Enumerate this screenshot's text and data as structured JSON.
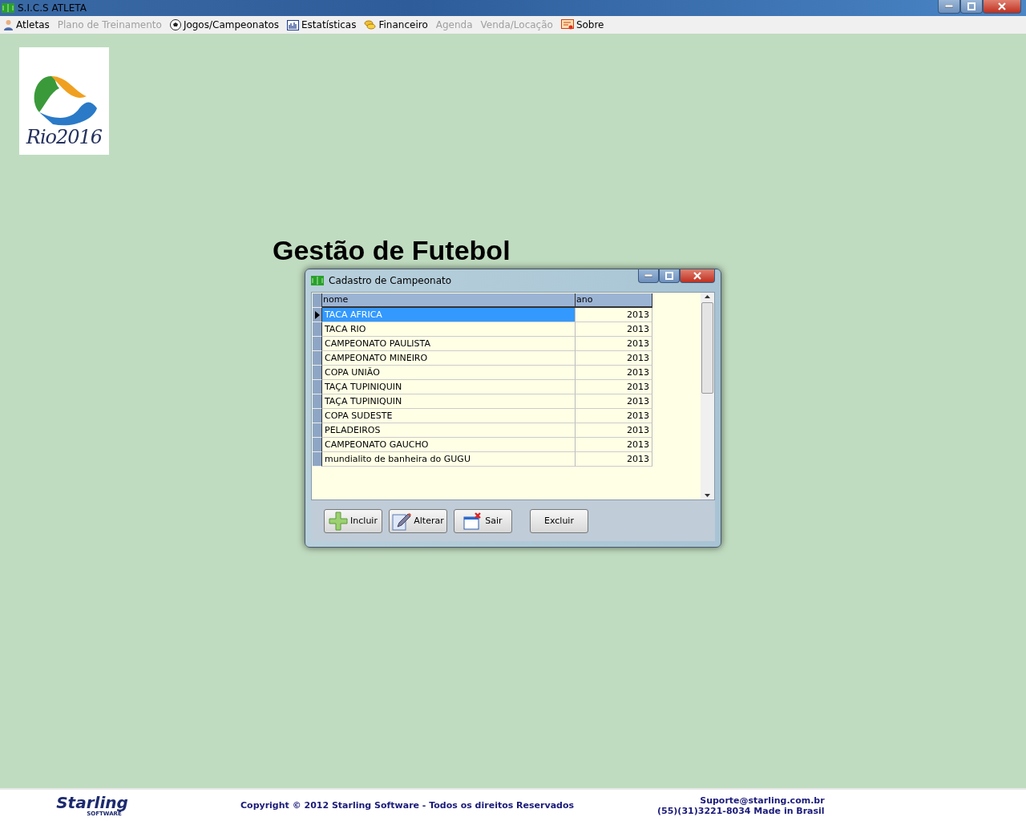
{
  "window": {
    "title": "S.I.C.S ATLETA"
  },
  "menu": [
    {
      "label": "Atletas",
      "disabled": false
    },
    {
      "label": "Plano de Treinamento",
      "disabled": true
    },
    {
      "label": "Jogos/Campeonatos",
      "disabled": false
    },
    {
      "label": "Estatísticas",
      "disabled": false
    },
    {
      "label": "Financeiro",
      "disabled": false
    },
    {
      "label": "Agenda",
      "disabled": true
    },
    {
      "label": "Venda/Locação",
      "disabled": true
    },
    {
      "label": "Sobre",
      "disabled": false
    }
  ],
  "logo": {
    "text": "Rio2016"
  },
  "heading": "Gestão de Futebol",
  "dialog": {
    "title": "Cadastro de Campeonato",
    "table": {
      "columns": [
        "nome",
        "ano"
      ],
      "rows": [
        {
          "nome": "TACA AFRICA",
          "ano": "2013",
          "selected": true
        },
        {
          "nome": "TACA RIO",
          "ano": "2013",
          "selected": false
        },
        {
          "nome": "CAMPEONATO PAULISTA",
          "ano": "2013",
          "selected": false
        },
        {
          "nome": "CAMPEONATO MINEIRO",
          "ano": "2013",
          "selected": false
        },
        {
          "nome": "COPA UNIÃO",
          "ano": "2013",
          "selected": false
        },
        {
          "nome": "TAÇA TUPINIQUIN",
          "ano": "2013",
          "selected": false
        },
        {
          "nome": "TAÇA TUPINIQUIN",
          "ano": "2013",
          "selected": false
        },
        {
          "nome": "COPA SUDESTE",
          "ano": "2013",
          "selected": false
        },
        {
          "nome": "PELADEIROS",
          "ano": "2013",
          "selected": false
        },
        {
          "nome": "CAMPEONATO GAUCHO",
          "ano": "2013",
          "selected": false
        },
        {
          "nome": "mundialito de banheira do GUGU",
          "ano": "2013",
          "selected": false
        }
      ]
    },
    "buttons": [
      {
        "label": "Incluir"
      },
      {
        "label": "Alterar"
      },
      {
        "label": "Sair"
      },
      {
        "label": "Excluir"
      }
    ]
  },
  "footer": {
    "brand": "Starling",
    "brand_sub": "SOFTWARE",
    "copyright": "Copyright © 2012 Starling Software - Todos os direitos Reservados",
    "email": "Suporte@starling.com.br",
    "phone": "(55)(31)3221-8034 Made in Brasil"
  }
}
